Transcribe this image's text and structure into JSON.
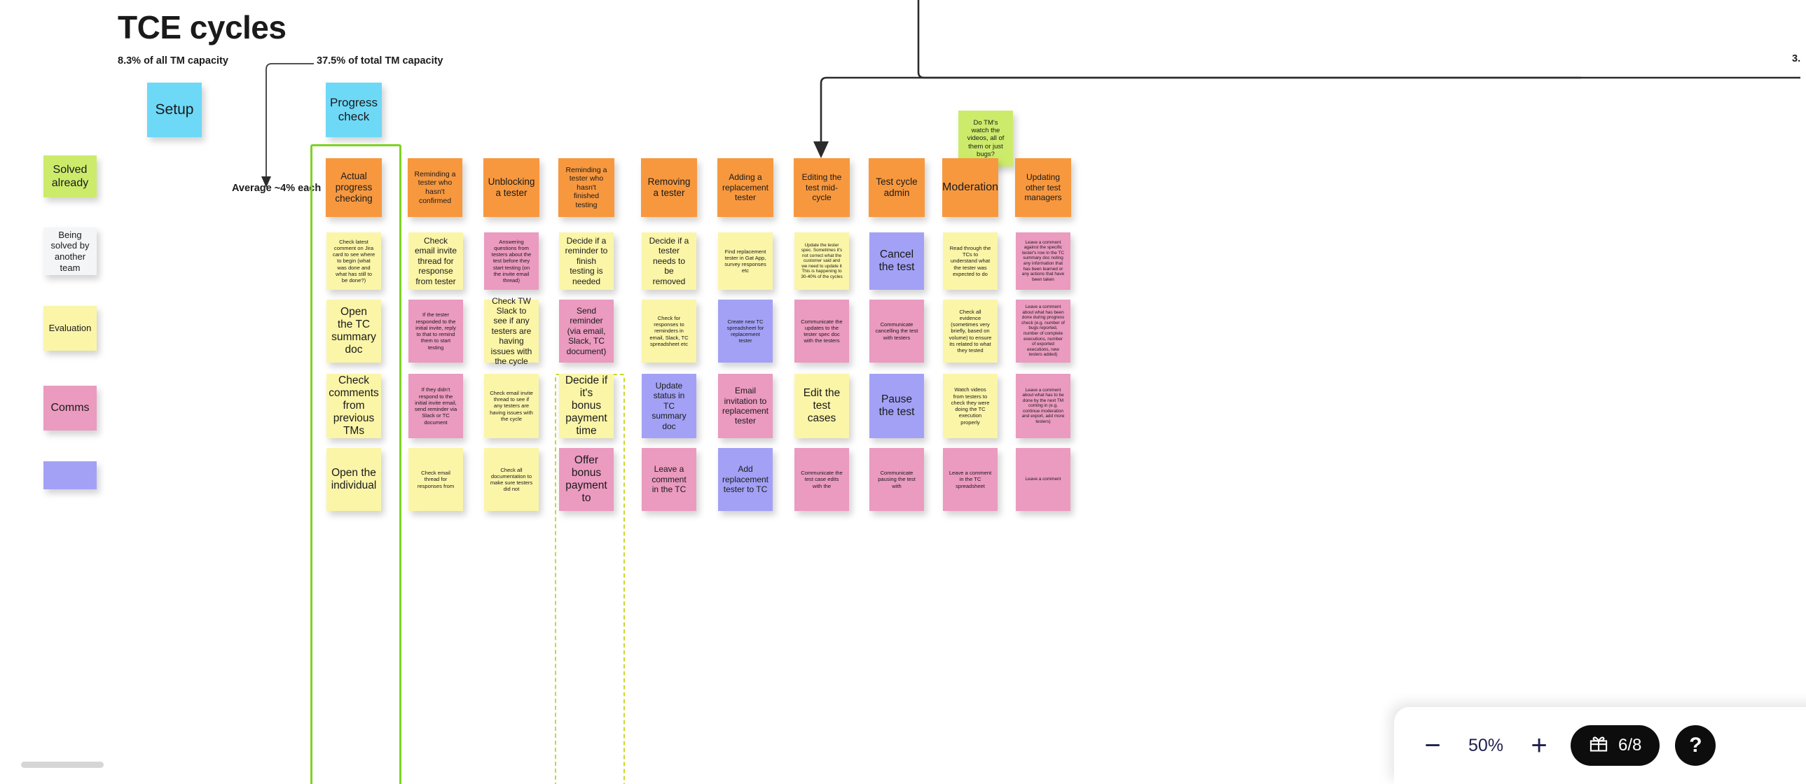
{
  "page": {
    "title": "TCE cycles",
    "zoom_level": "50%"
  },
  "annotations": {
    "setup_capacity": "8.3% of all TM capacity",
    "progress_capacity": "37.5% of total TM capacity",
    "average_each": "Average ~4% each",
    "right_partial": "3."
  },
  "legend": {
    "items": [
      {
        "label": "Solved already",
        "color": "#cdeb6b",
        "style": "green"
      },
      {
        "label": "Being solved by another team",
        "color": "#f4f5f7",
        "style": "white"
      },
      {
        "label": "Evaluation",
        "color": "#fbf5a8",
        "style": "yellow"
      },
      {
        "label": "Comms",
        "color": "#eb9ac0",
        "style": "pink"
      },
      {
        "label": "",
        "color": "#a3a1f5",
        "style": "purple"
      }
    ]
  },
  "phases": [
    {
      "label": "Setup",
      "color": "#6ed8f7"
    },
    {
      "label": "Progress\ncheck",
      "color": "#6ed8f7"
    }
  ],
  "question_note": {
    "label": "Do TM's watch the videos, all of them or just bugs?",
    "color": "#cdeb6b"
  },
  "columns": [
    {
      "header": "Actual progress checking",
      "cards": [
        {
          "text": "Check latest comment on Jira card to see where to begin (what was done and what has still to be done?)",
          "style": "yellow",
          "size": "small"
        },
        {
          "text": "Open the TC summary doc",
          "style": "yellow",
          "size": "big"
        },
        {
          "text": "Check comments from previous TMs",
          "style": "yellow",
          "size": "big"
        },
        {
          "text": "Open the individual",
          "style": "yellow",
          "size": "big"
        }
      ]
    },
    {
      "header": "Reminding a tester who hasn't confirmed",
      "cards": [
        {
          "text": "Check email invite thread for response from tester",
          "style": "yellow",
          "size": "mid"
        },
        {
          "text": "If the tester responded to the initial invite, reply to that to remind them to start testing",
          "style": "pink",
          "size": "small"
        },
        {
          "text": "If they didn't respond to the initial invite email, send reminder via Slack or TC document",
          "style": "pink",
          "size": "small"
        },
        {
          "text": "Check email thread for responses from",
          "style": "yellow",
          "size": "small"
        }
      ]
    },
    {
      "header": "Unblocking a tester",
      "cards": [
        {
          "text": "Answering questions from testers about the test before they start testing (on the invite email thread)",
          "style": "pink",
          "size": "small"
        },
        {
          "text": "Check TW Slack to see if any testers are having issues with the cycle",
          "style": "yellow",
          "size": "mid"
        },
        {
          "text": "Check email invite thread  to see if any testers are having issues with the cycle",
          "style": "yellow",
          "size": "small"
        },
        {
          "text": "Check all documentation to make sure testers did not",
          "style": "yellow",
          "size": "small"
        }
      ]
    },
    {
      "header": "Reminding a tester who hasn't finished testing",
      "cards": [
        {
          "text": "Decide if a reminder to finish testing is needed",
          "style": "yellow",
          "size": "mid"
        },
        {
          "text": "Send reminder (via email, Slack, TC document)",
          "style": "pink",
          "size": "mid"
        },
        {
          "text": "Decide if it's bonus payment time",
          "style": "yellow",
          "size": "big"
        },
        {
          "text": "Offer bonus payment to",
          "style": "pink",
          "size": "big"
        }
      ]
    },
    {
      "header": "Removing a tester",
      "cards": [
        {
          "text": "Decide if a tester needs to be removed",
          "style": "yellow",
          "size": "mid"
        },
        {
          "text": "Check for responses to reminders in email, Slack, TC spreadsheet etc",
          "style": "yellow",
          "size": "small"
        },
        {
          "text": "Update status in TC summary doc",
          "style": "purple",
          "size": "mid"
        },
        {
          "text": "Leave a comment in the TC",
          "style": "pink",
          "size": "mid"
        }
      ]
    },
    {
      "header": "Adding a replacement tester",
      "cards": [
        {
          "text": "Find replacement tester in Gat App, survey responses etc",
          "style": "yellow",
          "size": "small"
        },
        {
          "text": "Create new TC spreadsheet for replacement tester",
          "style": "purple",
          "size": "small"
        },
        {
          "text": "Email invitation to replacement tester",
          "style": "pink",
          "size": "mid"
        },
        {
          "text": "Add replacement tester to TC",
          "style": "purple",
          "size": "mid"
        }
      ]
    },
    {
      "header": "Editing the test mid-cycle",
      "cards": [
        {
          "text": "Update the tester spec. Sometimes it's not correct what the customer said and we need to update it This is happening to 30-40% of the cycles",
          "style": "yellow",
          "size": "tiny"
        },
        {
          "text": "Communicate the updates to the tester spec doc with the testers",
          "style": "pink",
          "size": "small"
        },
        {
          "text": "Edit the test cases",
          "style": "yellow",
          "size": "big"
        },
        {
          "text": "Communicate the test case edits with the",
          "style": "pink",
          "size": "small"
        }
      ]
    },
    {
      "header": "Test cycle admin",
      "cards": [
        {
          "text": "Cancel the test",
          "style": "purple",
          "size": "big"
        },
        {
          "text": "Communicate cancelling the test with testers",
          "style": "pink",
          "size": "small"
        },
        {
          "text": "Pause the test",
          "style": "purple",
          "size": "big"
        },
        {
          "text": "Communicate pausing the test with",
          "style": "pink",
          "size": "small"
        }
      ]
    },
    {
      "header": "Moderation",
      "cards": [
        {
          "text": "Read through the TCs to understand what the tester was expected to do",
          "style": "yellow",
          "size": "small"
        },
        {
          "text": "Check all evidence (sometimes very briefly, based on volume) to ensure its related to what they tested",
          "style": "yellow",
          "size": "small"
        },
        {
          "text": "Watch videos from testers to check they were doing the TC execution properly",
          "style": "yellow",
          "size": "small"
        },
        {
          "text": "Leave a comment in the TC spreadsheet",
          "style": "pink",
          "size": "small"
        }
      ]
    },
    {
      "header": "Updating other test managers",
      "cards": [
        {
          "text": "Leave a comment against the specific tester's row in the TC summary doc noting any information that has been learned or any actions that have been taken",
          "style": "pink",
          "size": "tiny"
        },
        {
          "text": "Leave a comment about what has been done during progress check (e.g. number of bugs reported, number of complete executions, number of exported executions, new testers added)",
          "style": "pink",
          "size": "tiny"
        },
        {
          "text": "Leave a comment about what has to be done by the next TM coming in (e.g. continue moderation and export, add more testers)",
          "style": "pink",
          "size": "tiny"
        },
        {
          "text": "Leave a comment",
          "style": "pink",
          "size": "tiny"
        }
      ]
    }
  ],
  "toolbar": {
    "zoom_out_label": "−",
    "zoom_in_label": "+",
    "zoom_value": "50%",
    "gift_count": "6/8",
    "help_label": "?"
  }
}
